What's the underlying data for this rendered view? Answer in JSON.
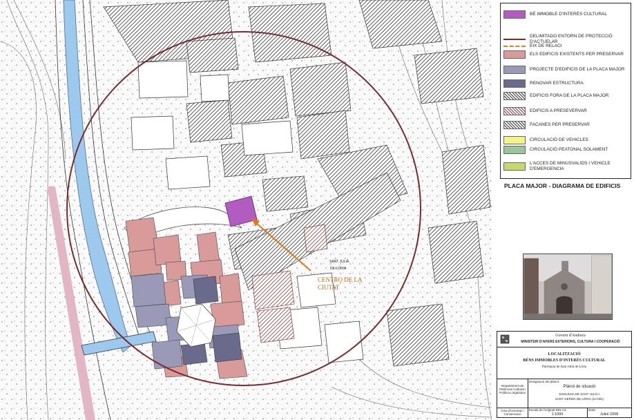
{
  "legend": {
    "items": [
      {
        "label": "BÉ IMMOBLE D'INTERÈS CULTURAL",
        "swatch": "#b25bc1",
        "kind": "fill"
      },
      {
        "label": "DELIMITADO ENTORN DE PROTECCIÓ D'ACTUELAR",
        "swatch": "#7a2a2a",
        "kind": "line"
      },
      {
        "label": "EIX DE RELACI",
        "swatch": "#e07a18",
        "kind": "dash"
      },
      {
        "label": "ELS EDIFICIS EXISTENTS PER PRESERVAR",
        "swatch": "#d99a9a",
        "kind": "fill"
      },
      {
        "label": "PROJECTE D'EDIFICIS DE LA PLACA MAJOR",
        "swatch": "#9a9ab8",
        "kind": "fill"
      },
      {
        "label": "RENOVAR ESTRUCTURA",
        "swatch": "#6a6a8c",
        "kind": "fill"
      },
      {
        "label": "EDIFICIS FORA DE LA PLACA MAJOR",
        "swatch": "#333333",
        "kind": "hatch"
      },
      {
        "label": "EDIFICIS A PRESEVERVAR",
        "swatch": "#8a3a3a",
        "kind": "hatch-red"
      },
      {
        "label": "FACANES PER PRESERVAR",
        "swatch": "#555555",
        "kind": "hatch"
      },
      {
        "label": "CIRCULACIÓ DE VEHICLES",
        "swatch": "#f3f38a",
        "kind": "fill"
      },
      {
        "label": "CIRCULACIÓ PEATONAL SOLAMENT",
        "swatch": "#9cc49c",
        "kind": "fill"
      },
      {
        "label": "L'ACCES DE MINUSVALIDS I VEHICLE D'EMERGENCIA",
        "swatch": "#c8d870",
        "kind": "fill"
      }
    ]
  },
  "plan_title": "PLACA MAJOR - DIAGRAMA DE EDIFICIS",
  "map": {
    "centre_label_1": "CENTRO DE LA",
    "centre_label_2": "CIUTAT",
    "street_label_1": "SANT JULIÀ",
    "street_label_2": "DE LÒRIA",
    "colors": {
      "river": "#9ec9ef",
      "circle": "#7a2a2a",
      "axis": "#e07a18",
      "bic": "#b25bc1",
      "preserve": "#d99a9a",
      "project": "#9a9ab8",
      "renovate": "#6a6a8c",
      "pink_road": "#e3b6c6"
    }
  },
  "titleblock": {
    "govern": "Govern d'Andorra",
    "ministry": "MINISTERI D'AFERS EXTERIORS, CULTURA I COOPERACIÓ",
    "loc_1": "LOCALITZACIÓ",
    "loc_2": "BÉNS IMMOBLES D'INTERÈS CULTURAL",
    "loc_3": "Parròquia de Sant Julià de Lòria",
    "dept": "Departament de Patrimoni Cultural i Política Lingüística",
    "plan_label": "Designació del plànol:",
    "plan_name": "Plànol de situació",
    "plan_desc_1": "ESGLÉSIA DE SANT JULIÀ I",
    "plan_desc_2": "SANT GERMÀ DE LÒRIA (SJ-001)",
    "area": "Àrea d'Inventari i Conservació",
    "scale_label": "Escala de l'original DIN-A3:",
    "scale": "1:1000",
    "date_label": "Data:",
    "date": "Juliol 2008"
  }
}
